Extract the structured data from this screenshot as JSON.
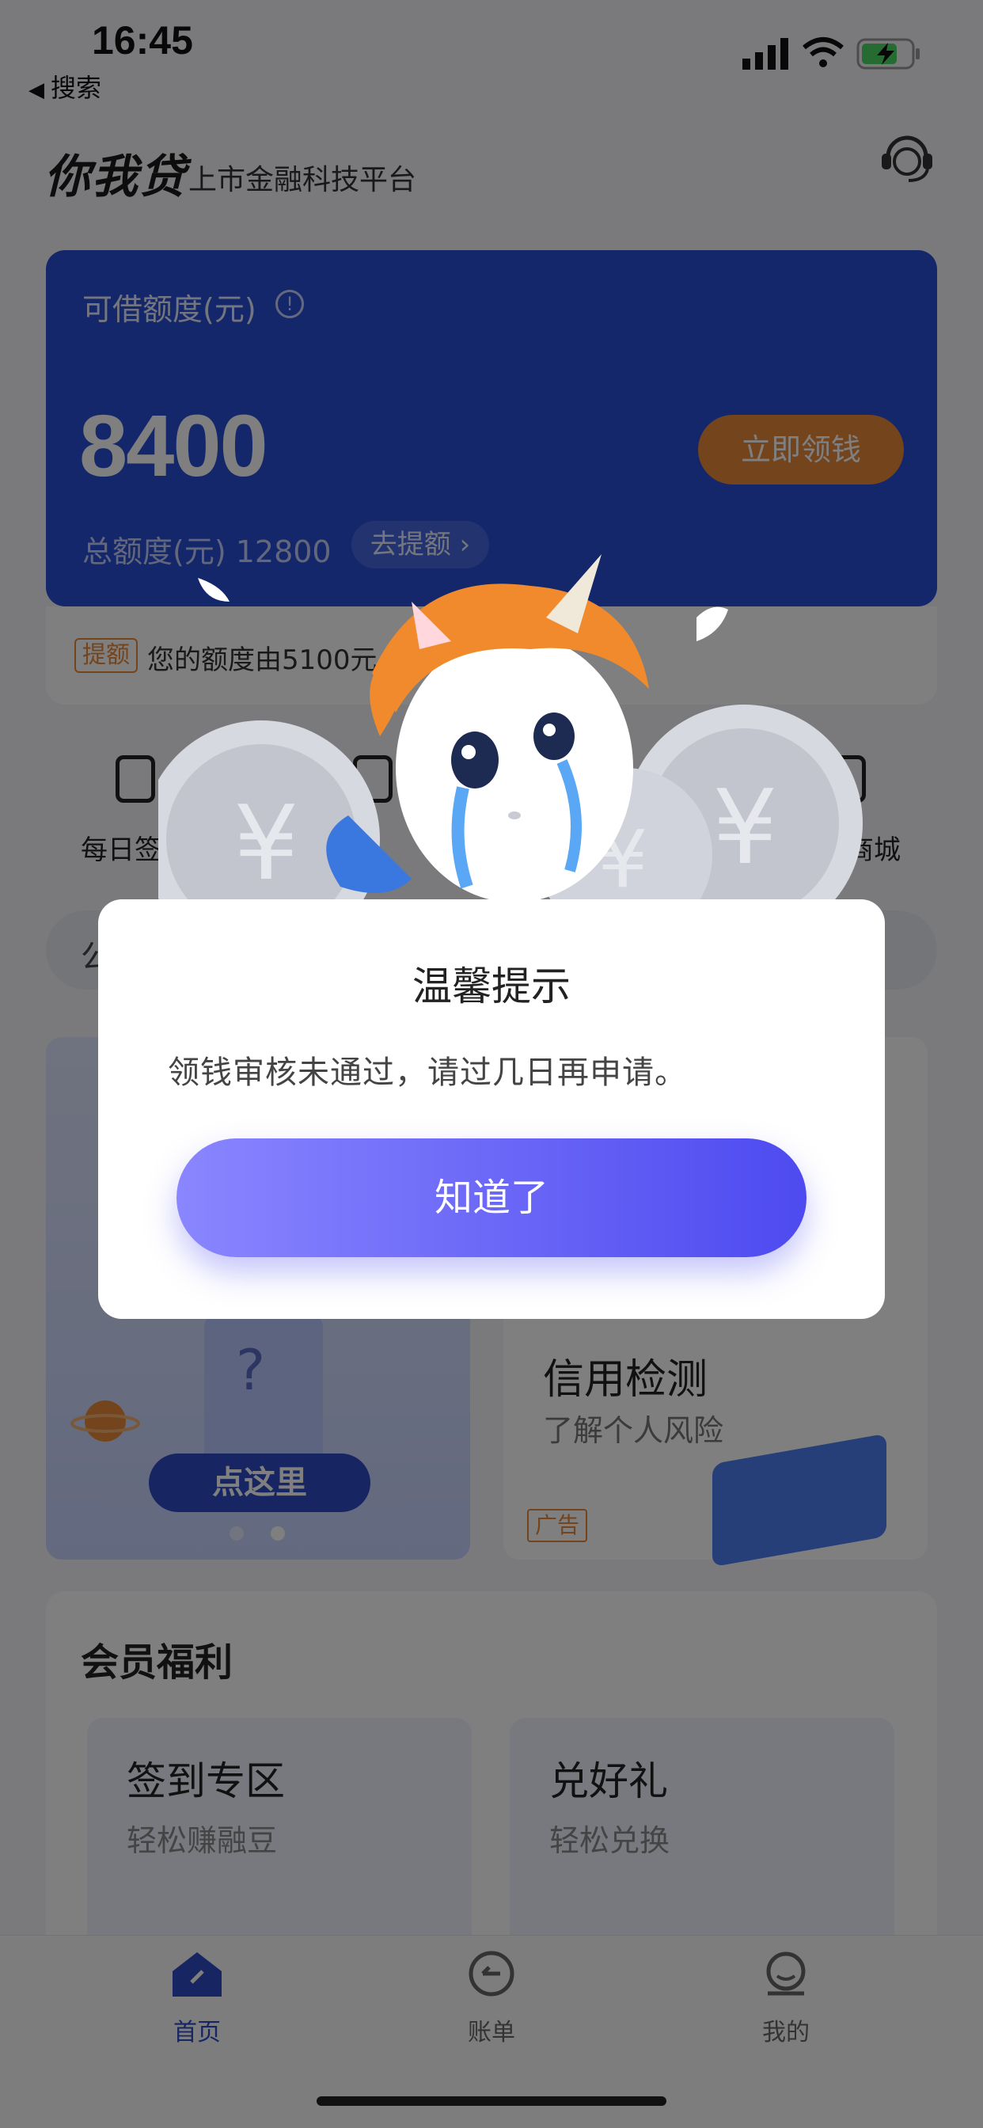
{
  "status_bar": {
    "time": "16:45",
    "back_label": "搜索"
  },
  "header": {
    "brand": "你我贷",
    "slogan": "上市金融科技平台"
  },
  "credit_card": {
    "quota_label": "可借额度(元)",
    "quota_value": "8400",
    "get_money_button": "立即领钱",
    "total_label": "总额度(元) 12800",
    "raise_button": "去提额 ›"
  },
  "notice": {
    "tag": "提额",
    "text": "您的额度由5100元"
  },
  "quick_entries": [
    {
      "label": "每日签",
      "icon": "phone-card-icon"
    },
    {
      "label": "",
      "icon": "wallet-icon"
    },
    {
      "label": "",
      "icon": "chat-icon"
    },
    {
      "label": "豆商城",
      "icon": "shopping-bag-icon"
    }
  ],
  "search_hint": "公",
  "promo": {
    "left_button": "点这里",
    "right_title": "信用检测",
    "right_subtitle": "了解个人风险",
    "ad_tag": "广告"
  },
  "benefits": {
    "title": "会员福利",
    "cards": [
      {
        "title": "签到专区",
        "subtitle": "轻松赚融豆"
      },
      {
        "title": "兑好礼",
        "subtitle": "轻松兑换"
      }
    ]
  },
  "tabbar": {
    "items": [
      {
        "label": "首页",
        "icon": "home-icon",
        "active": true
      },
      {
        "label": "账单",
        "icon": "bill-icon",
        "active": false
      },
      {
        "label": "我的",
        "icon": "profile-icon",
        "active": false
      }
    ]
  },
  "dialog": {
    "title": "温馨提示",
    "message": "领钱审核未通过，请过几日再申请。",
    "ok_button": "知道了"
  },
  "colors": {
    "card_blue": "#2b4ed6",
    "accent_orange": "#e8893a",
    "tab_active": "#2f4cc7",
    "button_gradient_start": "#8a86ff",
    "button_gradient_end": "#4d4af0"
  }
}
